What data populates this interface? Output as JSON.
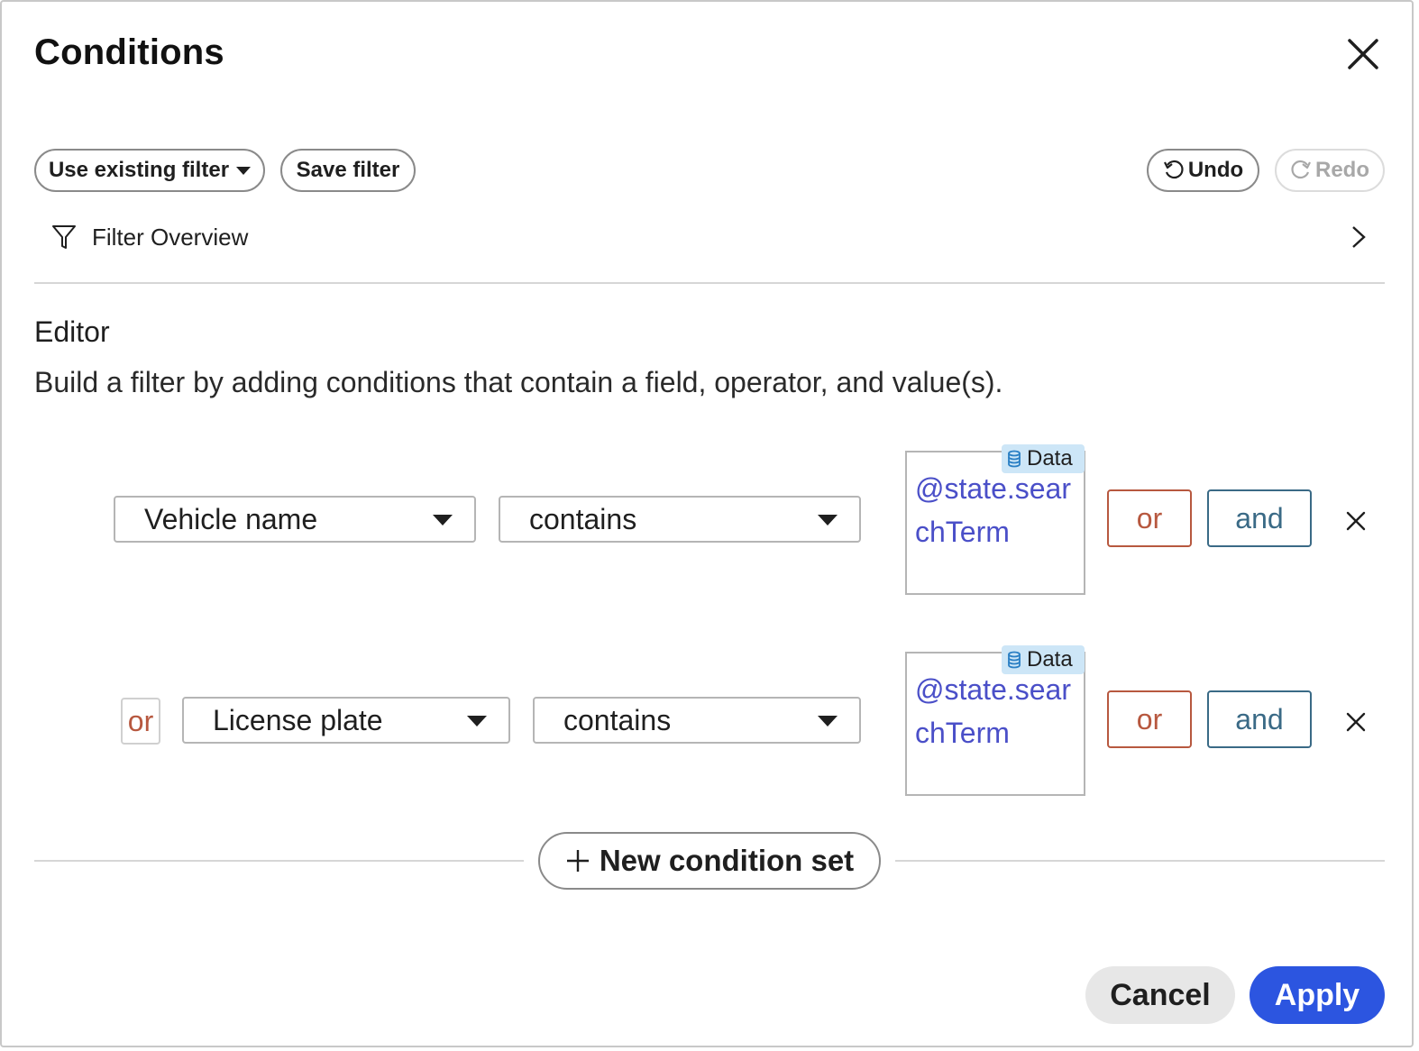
{
  "dialog": {
    "title": "Conditions"
  },
  "toolbar": {
    "use_existing_filter": "Use existing filter",
    "save_filter": "Save filter",
    "undo": "Undo",
    "redo": "Redo",
    "redo_disabled": true
  },
  "overview": {
    "label": "Filter Overview"
  },
  "editor": {
    "title": "Editor",
    "description": "Build a filter by adding conditions that contain a field, operator, and value(s).",
    "badge_label": "Data",
    "or_label": "or",
    "and_label": "and",
    "rows": [
      {
        "connector": "",
        "field": "Vehicle name",
        "operator": "contains",
        "value": "@state.searchTerm"
      },
      {
        "connector": "or",
        "field": "License plate",
        "operator": "contains",
        "value": "@state.searchTerm"
      }
    ],
    "new_condition_set": "New condition set"
  },
  "footer": {
    "cancel": "Cancel",
    "apply": "Apply"
  },
  "colors": {
    "apply": "#2c55e0",
    "or": "#b7583f",
    "and": "#3a6a86",
    "value_text": "#4a4fc8",
    "badge_bg": "#cde6f7"
  },
  "icons": [
    "close-icon",
    "chevron-down-icon",
    "undo-icon",
    "redo-icon",
    "filter-icon",
    "chevron-right-icon",
    "database-icon",
    "remove-row-icon",
    "plus-icon"
  ]
}
